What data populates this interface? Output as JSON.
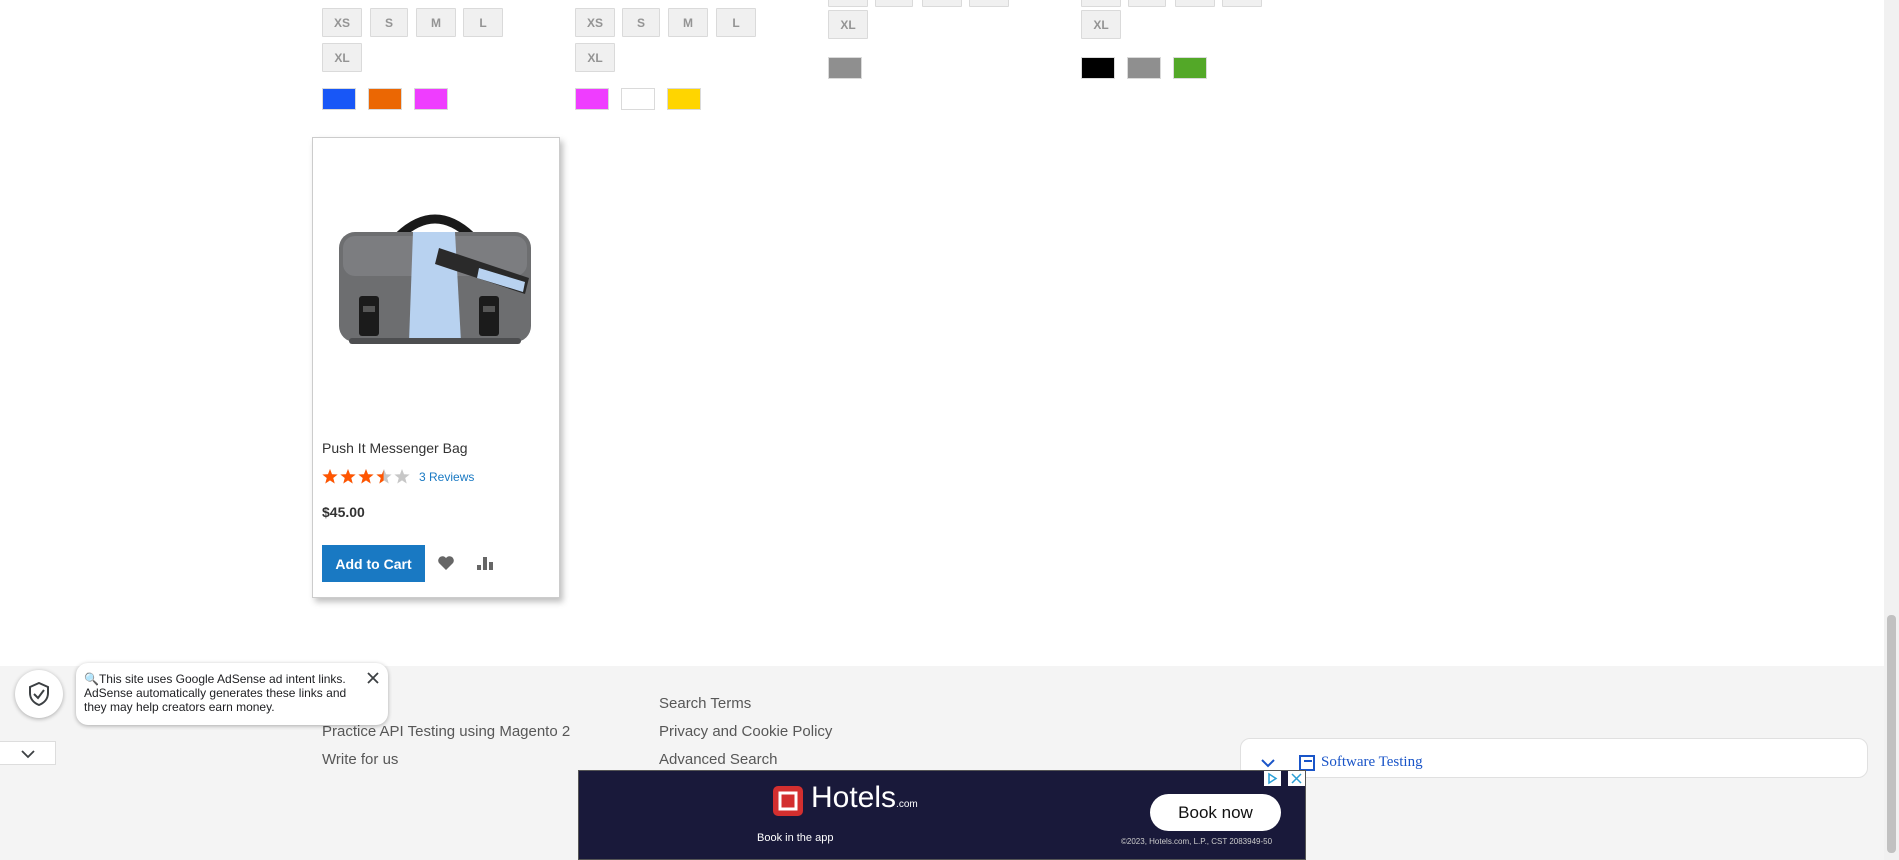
{
  "size_swatches": {
    "col1_row1": [
      "XS",
      "S",
      "M",
      "L"
    ],
    "col1_row2": [
      "XL"
    ],
    "col2_row1": [
      "XS",
      "S",
      "M",
      "L"
    ],
    "col2_row2": [
      "XL"
    ],
    "col3_row2": [
      "XL"
    ],
    "col4_row2": [
      "XL"
    ]
  },
  "color_swatches": {
    "col1": [
      "#1857f7",
      "#eb6703",
      "#ef3dff"
    ],
    "col2": [
      "#ef3dff",
      "#ffffff",
      "#ffd500"
    ],
    "col3": [
      "#8f8f8f"
    ],
    "col4": [
      "#000000",
      "#8f8f8f",
      "#53a828"
    ]
  },
  "product": {
    "name": "Push It Messenger Bag",
    "rating_percent": 70,
    "reviews_label": "3 Reviews",
    "price": "$45.00",
    "add_to_cart": "Add to Cart"
  },
  "footer": {
    "col1": [
      "Practice API Testing using Magento 2",
      "Write for us"
    ],
    "col2": [
      "Search Terms",
      "Privacy and Cookie Policy",
      "Advanced Search"
    ]
  },
  "adsense_notice": {
    "text": "This site uses Google AdSense ad intent links. AdSense automatically generates these links and they may help creators earn money."
  },
  "partial_card": {
    "label": "Software Testing"
  },
  "ad": {
    "brand": "Hotels",
    "brand_suffix": ".com",
    "tagline": "Book in the app",
    "cta": "Book now",
    "legal": "©2023, Hotels.com, L.P., CST 2083949-50"
  },
  "colors": {
    "accent": "#1979c3",
    "star": "#ff5501",
    "ad_bg": "#19193a"
  }
}
